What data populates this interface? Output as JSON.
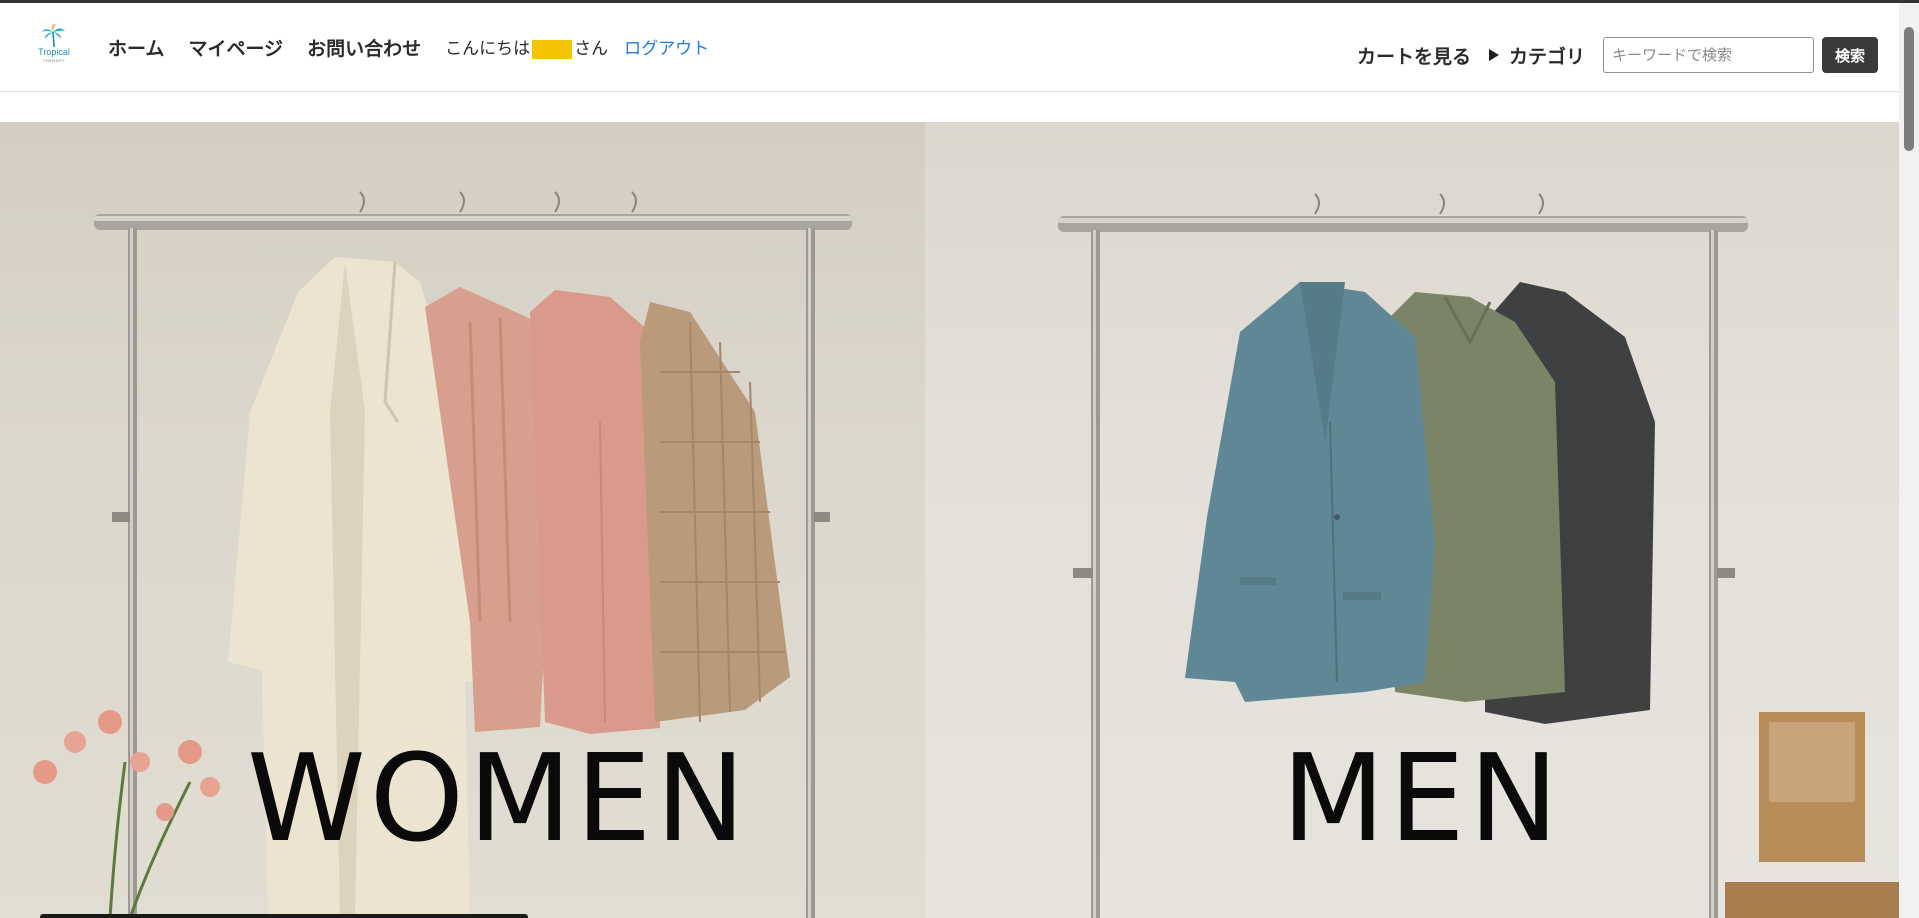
{
  "header": {
    "logo": {
      "name": "Tropical",
      "sub": "THERAPY",
      "icon": "palm-tree-icon"
    },
    "nav": [
      {
        "label": "ホーム"
      },
      {
        "label": "マイページ"
      },
      {
        "label": "お問い合わせ"
      }
    ],
    "greeting_prefix": "こんにちは",
    "greeting_suffix": "さん",
    "logout_label": "ログアウト",
    "cart_label": "カートを見る",
    "category_label": "カテゴリ",
    "search": {
      "placeholder": "キーワードで検索",
      "button_label": "検索"
    }
  },
  "hero": {
    "panels": [
      {
        "label": "WOMEN",
        "image": "women-clothing-rack"
      },
      {
        "label": "MEN",
        "image": "men-clothing-rack"
      }
    ]
  },
  "colors": {
    "accent_link": "#1e7be0",
    "redacted": "#f5c400",
    "button_dark": "#3a3a3a"
  }
}
